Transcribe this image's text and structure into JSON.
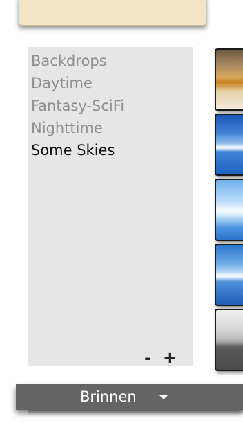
{
  "categories": {
    "items": [
      {
        "label": "Backdrops",
        "selected": false
      },
      {
        "label": "Daytime",
        "selected": false
      },
      {
        "label": "Fantasy-SciFi",
        "selected": false
      },
      {
        "label": "Nighttime",
        "selected": false
      },
      {
        "label": "Some Skies",
        "selected": true
      }
    ],
    "remove_label": "-",
    "add_label": "+"
  },
  "thumbnails": [
    {
      "name": "sky-thumbnail-sunset"
    },
    {
      "name": "sky-thumbnail-blue"
    },
    {
      "name": "sky-thumbnail-bright"
    },
    {
      "name": "sky-thumbnail-clear"
    },
    {
      "name": "sky-thumbnail-gray"
    }
  ],
  "footer": {
    "label": "Brinnen",
    "icon": "caret-down-icon"
  },
  "colors": {
    "list_background": "#e6e6e6",
    "unselected_text": "#8f8f8f",
    "selected_text": "#101010",
    "footer_background": "#646464",
    "top_panel": "#f3e4c7"
  }
}
